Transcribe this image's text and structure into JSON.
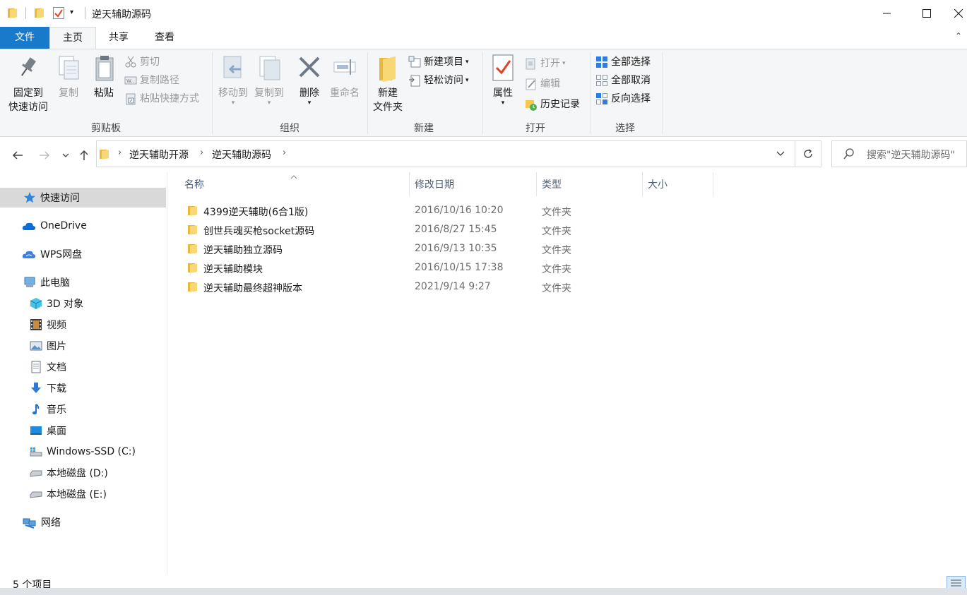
{
  "window": {
    "title": "逆天辅助源码",
    "controls": [
      "minimize",
      "maximize",
      "close"
    ]
  },
  "ribbon_tabs": [
    {
      "label": "文件",
      "active": false
    },
    {
      "label": "主页",
      "active": true
    },
    {
      "label": "共享",
      "active": false
    },
    {
      "label": "查看",
      "active": false
    }
  ],
  "ribbon": {
    "clipboard": {
      "label": "剪贴板",
      "pin": {
        "line1": "固定到",
        "line2": "快速访问"
      },
      "copy": "复制",
      "paste": "粘贴",
      "cut": "剪切",
      "copy_path": "复制路径",
      "paste_shortcut": "粘贴快捷方式"
    },
    "organize": {
      "label": "组织",
      "move_to": "移动到",
      "copy_to": "复制到",
      "delete": "删除",
      "rename": "重命名"
    },
    "new": {
      "label": "新建",
      "new_folder": {
        "line1": "新建",
        "line2": "文件夹"
      },
      "new_item": "新建项目",
      "easy_access": "轻松访问"
    },
    "open": {
      "label": "打开",
      "properties": "属性",
      "open": "打开",
      "edit": "编辑",
      "history": "历史记录"
    },
    "select": {
      "label": "选择",
      "select_all": "全部选择",
      "select_none": "全部取消",
      "invert": "反向选择"
    }
  },
  "address": {
    "breadcrumb": [
      "逆天辅助开源",
      "逆天辅助源码"
    ],
    "search_placeholder": "搜索\"逆天辅助源码\""
  },
  "nav_pane": {
    "items": [
      {
        "label": "快速访问",
        "icon": "star-icon",
        "selected": true
      },
      {
        "label": "OneDrive",
        "icon": "cloud-icon"
      },
      {
        "label": "WPS网盘",
        "icon": "wps-cloud-icon"
      },
      {
        "label": "此电脑",
        "icon": "computer-icon"
      },
      {
        "label": "3D 对象",
        "icon": "cube-icon"
      },
      {
        "label": "视频",
        "icon": "film-icon"
      },
      {
        "label": "图片",
        "icon": "picture-icon"
      },
      {
        "label": "文档",
        "icon": "document-icon"
      },
      {
        "label": "下载",
        "icon": "download-arrow-icon"
      },
      {
        "label": "音乐",
        "icon": "music-note-icon"
      },
      {
        "label": "桌面",
        "icon": "desktop-icon"
      },
      {
        "label": "Windows-SSD (C:)",
        "icon": "drive-windows-icon"
      },
      {
        "label": "本地磁盘 (D:)",
        "icon": "drive-icon"
      },
      {
        "label": "本地磁盘 (E:)",
        "icon": "drive-icon"
      },
      {
        "label": "网络",
        "icon": "network-icon"
      }
    ]
  },
  "file_list": {
    "columns": [
      "名称",
      "修改日期",
      "类型",
      "大小"
    ],
    "rows": [
      {
        "name": "4399逆天辅助(6合1版)",
        "date": "2016/10/16 10:20",
        "type": "文件夹"
      },
      {
        "name": "创世兵魂买枪socket源码",
        "date": "2016/8/27 15:45",
        "type": "文件夹"
      },
      {
        "name": "逆天辅助独立源码",
        "date": "2016/9/13 10:35",
        "type": "文件夹"
      },
      {
        "name": "逆天辅助模块",
        "date": "2016/10/15 17:38",
        "type": "文件夹"
      },
      {
        "name": "逆天辅助最终超神版本",
        "date": "2021/9/14 9:27",
        "type": "文件夹"
      }
    ]
  },
  "status": {
    "item_count": "5 个项目"
  },
  "colors": {
    "file_tab": "#1979ca",
    "ribbon_bg": "#f5f6f7",
    "folder_yellow": "#f8d775",
    "selected_nav": "#d9d9d9"
  }
}
